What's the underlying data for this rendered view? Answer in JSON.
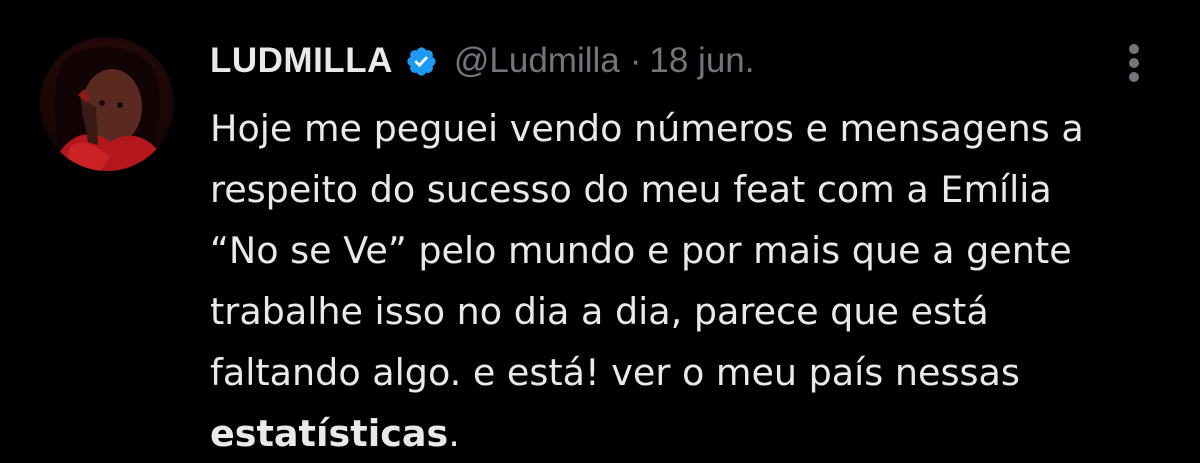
{
  "tweet": {
    "display_name": "LUDMILLA",
    "handle": "@Ludmilla",
    "separator": "·",
    "date": "18 jun.",
    "text_lines": [
      "Hoje me peguei vendo números e mensagens a",
      "respeito do sucesso do meu feat com a Emília",
      "“No se Ve” pelo mundo e por mais que a gente",
      "trabalhe isso no dia a dia, parece que está",
      "faltando algo. e está! ver o meu país nessas"
    ],
    "last_line_bold": "estatísticas",
    "last_line_tail": ".",
    "verified_color": "#1d9bf0",
    "more_icon": "more-vertical-icon"
  }
}
